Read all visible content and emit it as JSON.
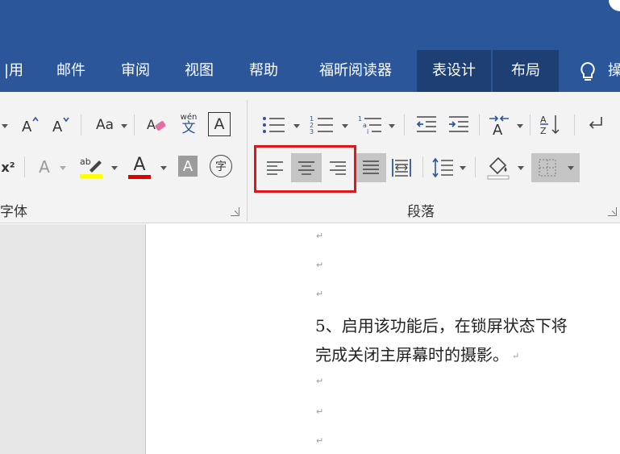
{
  "tabs": [
    {
      "label": "引用",
      "display": "|用"
    },
    {
      "label": "邮件"
    },
    {
      "label": "审阅"
    },
    {
      "label": "视图"
    },
    {
      "label": "帮助"
    },
    {
      "label": "福昕阅读器"
    },
    {
      "label": "表设计"
    },
    {
      "label": "布局"
    }
  ],
  "tab_cut_label": "操",
  "ribbon": {
    "font_group_label": "字体",
    "paragraph_group_label": "段落",
    "font": {
      "change_case_label": "Aa",
      "phonetic_top": "wén",
      "phonetic_bottom": "文",
      "char_border_label": "A",
      "superscript_label": "x²",
      "text_effect_label": "A",
      "highlight_label": "ab",
      "font_color_label": "A",
      "char_shading_label": "A",
      "enclose_char_label": "字"
    },
    "paragraph": {
      "sort_label": "A↓"
    }
  },
  "colors": {
    "title_bar": "#2b579a",
    "contextual_tab": "#1e3f73",
    "highlight_yellow": "#ffff00",
    "font_color_red": "#e00000",
    "annotation_red": "#e0161a"
  },
  "document": {
    "paragraph_mark": "↵",
    "line1": "5、启用该功能后，在锁屏状态下将",
    "line2": "完成关闭主屏幕时的摄影。"
  }
}
